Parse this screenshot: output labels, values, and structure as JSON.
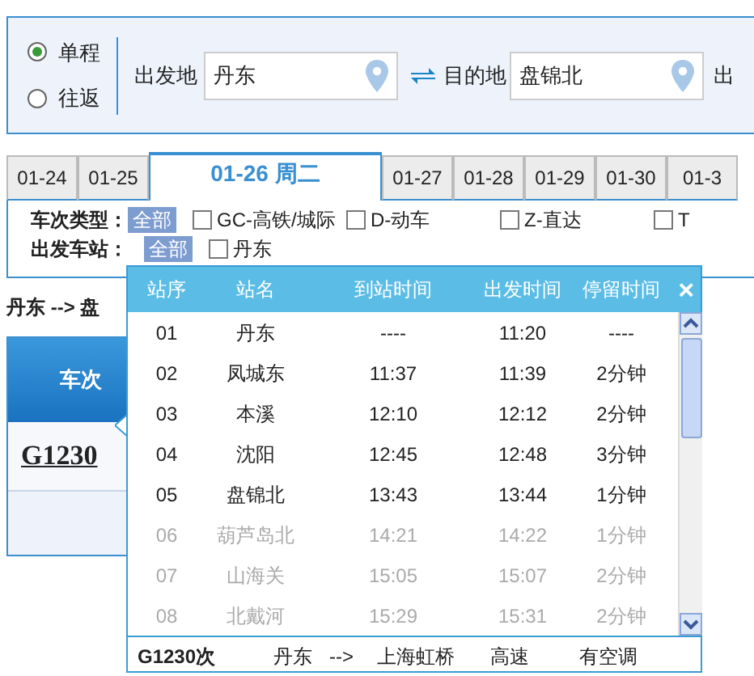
{
  "trip_type": [
    {
      "label": "单程",
      "selected": true
    },
    {
      "label": "往返",
      "selected": false
    }
  ],
  "from": {
    "label": "出发地",
    "value": "丹东"
  },
  "to": {
    "label": "目的地",
    "value": "盘锦北"
  },
  "date_label": "出",
  "date_tabs": [
    {
      "label": "01-24",
      "selected": false
    },
    {
      "label": "01-25",
      "selected": false
    },
    {
      "label": "01-26 周二",
      "selected": true
    },
    {
      "label": "01-27",
      "selected": false
    },
    {
      "label": "01-28",
      "selected": false
    },
    {
      "label": "01-29",
      "selected": false
    },
    {
      "label": "01-30",
      "selected": false
    },
    {
      "label": "01-3",
      "selected": false
    }
  ],
  "filters": [
    {
      "label": "车次类型：",
      "all": "全部",
      "options": [
        {
          "label": "GC-高铁/城际",
          "checked": false
        },
        {
          "label": "D-动车",
          "checked": false
        },
        {
          "label": "Z-直达",
          "checked": false
        },
        {
          "label": "T",
          "checked": false
        }
      ]
    },
    {
      "label": "出发车站：",
      "all": "全部",
      "options": [
        {
          "label": "丹东",
          "checked": false
        }
      ]
    }
  ],
  "route": "丹东 --> 盘",
  "table": {
    "column": "车次",
    "rows": [
      {
        "train": "G1230"
      }
    ]
  },
  "popup": {
    "columns": [
      "站序",
      "站名",
      "到站时间",
      "出发时间",
      "停留时间"
    ],
    "close": "×",
    "stops": [
      {
        "no": "01",
        "station": "丹东",
        "arrive": "----",
        "depart": "11:20",
        "stay": "----",
        "dimmed": false
      },
      {
        "no": "02",
        "station": "凤城东",
        "arrive": "11:37",
        "depart": "11:39",
        "stay": "2分钟",
        "dimmed": false
      },
      {
        "no": "03",
        "station": "本溪",
        "arrive": "12:10",
        "depart": "12:12",
        "stay": "2分钟",
        "dimmed": false
      },
      {
        "no": "04",
        "station": "沈阳",
        "arrive": "12:45",
        "depart": "12:48",
        "stay": "3分钟",
        "dimmed": false
      },
      {
        "no": "05",
        "station": "盘锦北",
        "arrive": "13:43",
        "depart": "13:44",
        "stay": "1分钟",
        "dimmed": false
      },
      {
        "no": "06",
        "station": "葫芦岛北",
        "arrive": "14:21",
        "depart": "14:22",
        "stay": "1分钟",
        "dimmed": true
      },
      {
        "no": "07",
        "station": "山海关",
        "arrive": "15:05",
        "depart": "15:07",
        "stay": "2分钟",
        "dimmed": true
      },
      {
        "no": "08",
        "station": "北戴河",
        "arrive": "15:29",
        "depart": "15:31",
        "stay": "2分钟",
        "dimmed": true
      }
    ],
    "footer": {
      "train": "G1230次",
      "from": "丹东",
      "arrow": "-->",
      "to": "上海虹桥",
      "type": "高速",
      "ac": "有空调"
    }
  }
}
